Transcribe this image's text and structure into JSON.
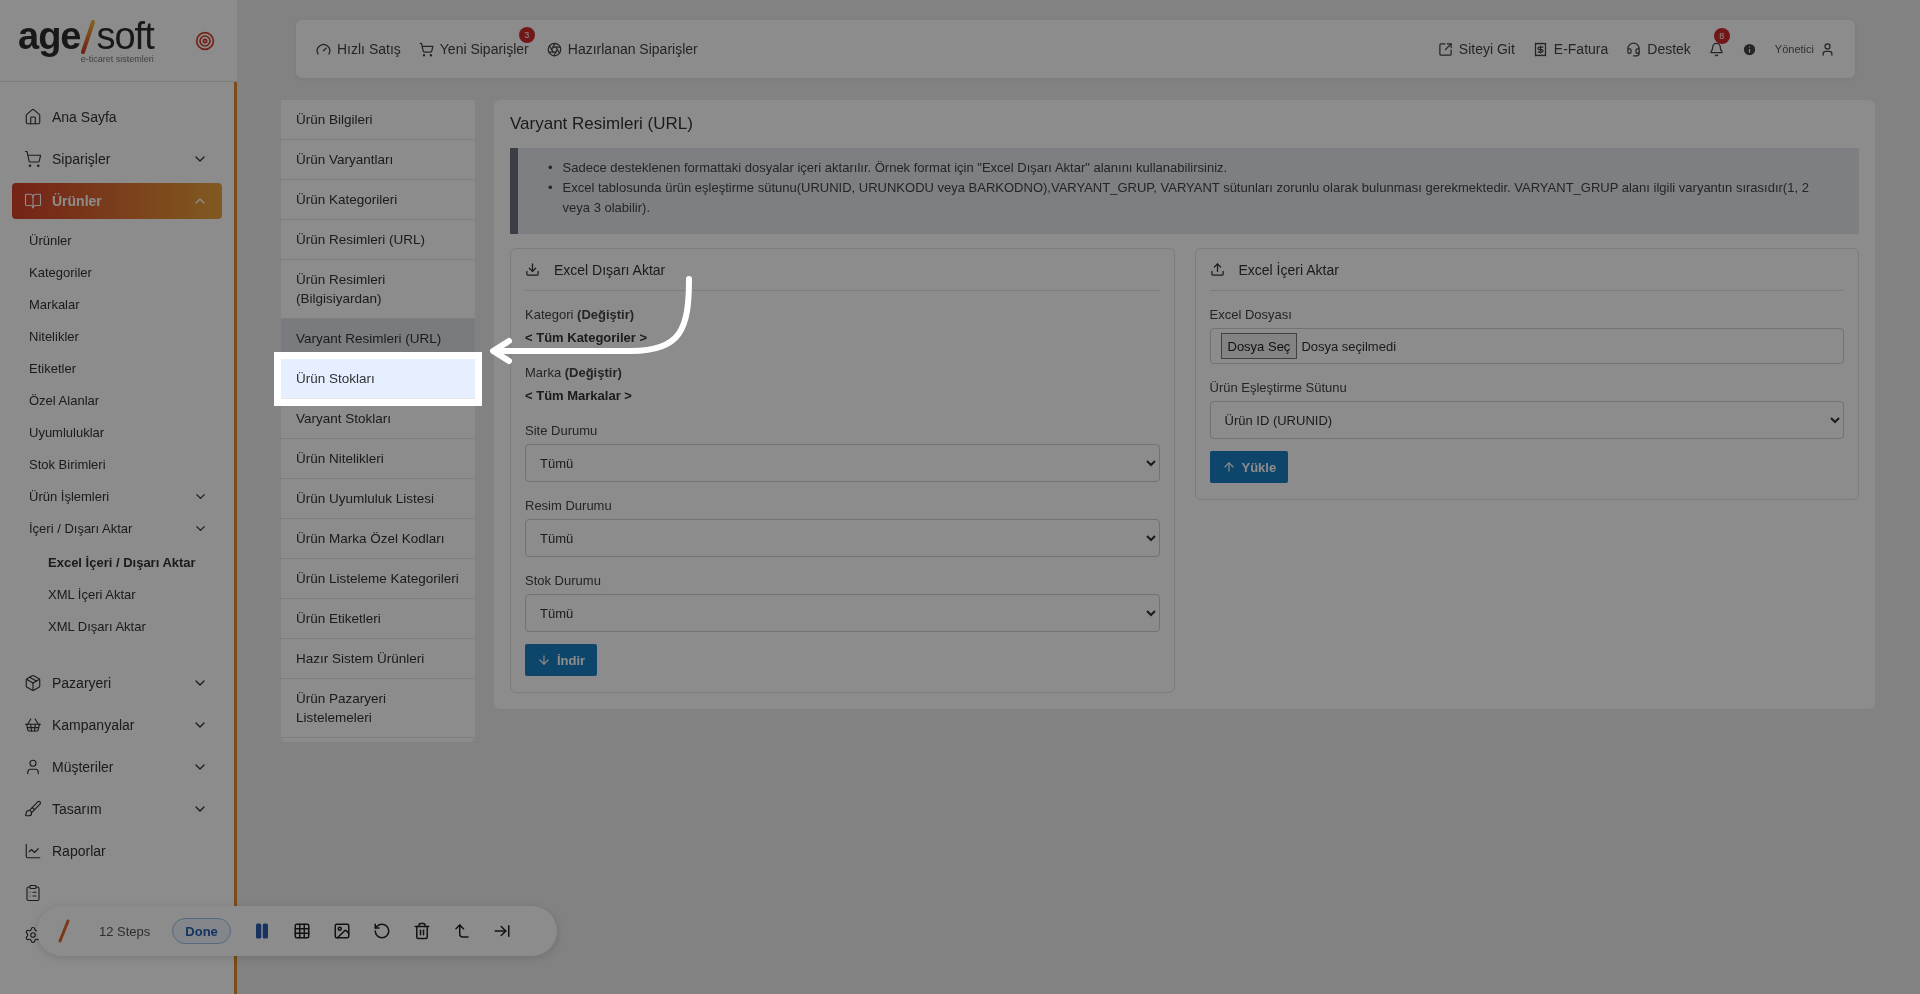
{
  "logo": {
    "brand_start": "age",
    "brand_end": "soft",
    "tagline": "e-ticaret sistemleri"
  },
  "sidebar": {
    "items": [
      {
        "label": "Ana Sayfa",
        "selected": false
      },
      {
        "label": "Siparişler",
        "selected": false,
        "expanded": false
      },
      {
        "label": "Ürünler",
        "selected": true,
        "expanded": true,
        "children": [
          {
            "label": "Ürünler",
            "selected": false
          },
          {
            "label": "Kategoriler",
            "selected": false
          },
          {
            "label": "Markalar",
            "selected": false
          },
          {
            "label": "Nitelikler",
            "selected": false
          },
          {
            "label": "Etiketler",
            "selected": false
          },
          {
            "label": "Özel Alanlar",
            "selected": false
          },
          {
            "label": "Uyumluluklar",
            "selected": false
          },
          {
            "label": "Stok Birimleri",
            "selected": false
          },
          {
            "label": "Ürün İşlemleri",
            "selected": false,
            "expanded": false
          },
          {
            "label": "İçeri / Dışarı Aktar",
            "selected": false,
            "expanded": true,
            "children": [
              {
                "label": "Excel İçeri / Dışarı Aktar",
                "selected": true
              },
              {
                "label": "XML İçeri Aktar",
                "selected": false
              },
              {
                "label": "XML Dışarı Aktar",
                "selected": false
              }
            ]
          }
        ]
      },
      {
        "label": "Pazaryeri",
        "selected": false,
        "expanded": false
      },
      {
        "label": "Kampanyalar",
        "selected": false,
        "expanded": false
      },
      {
        "label": "Müşteriler",
        "selected": false,
        "expanded": false
      },
      {
        "label": "Tasarım",
        "selected": false,
        "expanded": false
      },
      {
        "label": "Raporlar",
        "selected": false
      },
      {
        "selected": false
      },
      {
        "selected": false
      }
    ]
  },
  "topbar": {
    "quick_links": [
      {
        "label": "Hızlı Satış"
      },
      {
        "label": "Yeni Siparişler",
        "badge": "3"
      },
      {
        "label": "Hazırlanan Siparişler"
      }
    ],
    "right_links": [
      {
        "label": "Siteyi Git"
      },
      {
        "label": "E-Fatura"
      },
      {
        "label": "Destek"
      }
    ],
    "notifications": {
      "badge": "8"
    },
    "user": {
      "name": "Yönetici"
    }
  },
  "submenu": [
    {
      "label": "Ürün Bilgileri",
      "selected": false,
      "highlighted": false
    },
    {
      "label": "Ürün Varyantları",
      "selected": false,
      "highlighted": false
    },
    {
      "label": "Ürün Kategorileri",
      "selected": false,
      "highlighted": false
    },
    {
      "label": "Ürün Resimleri (URL)",
      "selected": false,
      "highlighted": false
    },
    {
      "label": "Ürün Resimleri (Bilgisiyardan)",
      "selected": false,
      "highlighted": false
    },
    {
      "label": "Varyant Resimleri (URL)",
      "selected": true,
      "highlighted": false
    },
    {
      "label": "Ürün Stokları",
      "selected": false,
      "highlighted": true
    },
    {
      "label": "Varyant Stokları",
      "selected": false,
      "highlighted": false
    },
    {
      "label": "Ürün Nitelikleri",
      "selected": false,
      "highlighted": false
    },
    {
      "label": "Ürün Uyumluluk Listesi",
      "selected": false,
      "highlighted": false
    },
    {
      "label": "Ürün Marka Özel Kodları",
      "selected": false,
      "highlighted": false
    },
    {
      "label": "Ürün Listeleme Kategorileri",
      "selected": false,
      "highlighted": false
    },
    {
      "label": "Ürün Etiketleri",
      "selected": false,
      "highlighted": false
    },
    {
      "label": "Hazır Sistem Ürünleri",
      "selected": false,
      "highlighted": false
    },
    {
      "label": "Ürün Pazaryeri Listelemeleri",
      "selected": false,
      "highlighted": false
    }
  ],
  "main": {
    "title": "Varyant Resimleri (URL)",
    "note_marker": "•",
    "notes": [
      "Sadece desteklenen formattaki dosyalar içeri aktarılır. Örnek format için \"Excel Dışarı Aktar\" alanını kullanabilirsiniz.",
      "Excel tablosunda ürün eşleştirme sütunu(URUNID, URUNKODU veya BARKODNO),VARYANT_GRUP, VARYANT sütunları zorunlu olarak bulunması gerekmektedir. VARYANT_GRUP alanı ilgili varyantın sırasıdır(1, 2 veya 3 olabilir)."
    ],
    "export": {
      "title": "Excel Dışarı Aktar",
      "filters": [
        {
          "label": "Kategori **(Değiştir)**",
          "value": "< Tüm Kategoriler >"
        },
        {
          "label": "Marka **(Değiştir)**",
          "value": "< Tüm Markalar >"
        }
      ],
      "selects": [
        {
          "label": "Site Durumu",
          "value": "Tümü"
        },
        {
          "label": "Resim Durumu",
          "value": "Tümü"
        },
        {
          "label": "Stok Durumu",
          "value": "Tümü"
        }
      ],
      "button": "İndir"
    },
    "import": {
      "title": "Excel İçeri Aktar",
      "file_label": "Excel Dosyası",
      "file_button": "Dosya Seç",
      "file_status": "Dosya seçilmedi",
      "match_label": "Ürün Eşleştirme Sütunu",
      "match_value": "Ürün ID (URUNID)",
      "button": "Yükle"
    }
  },
  "recorder": {
    "steps": "12 Steps",
    "done": "Done"
  }
}
